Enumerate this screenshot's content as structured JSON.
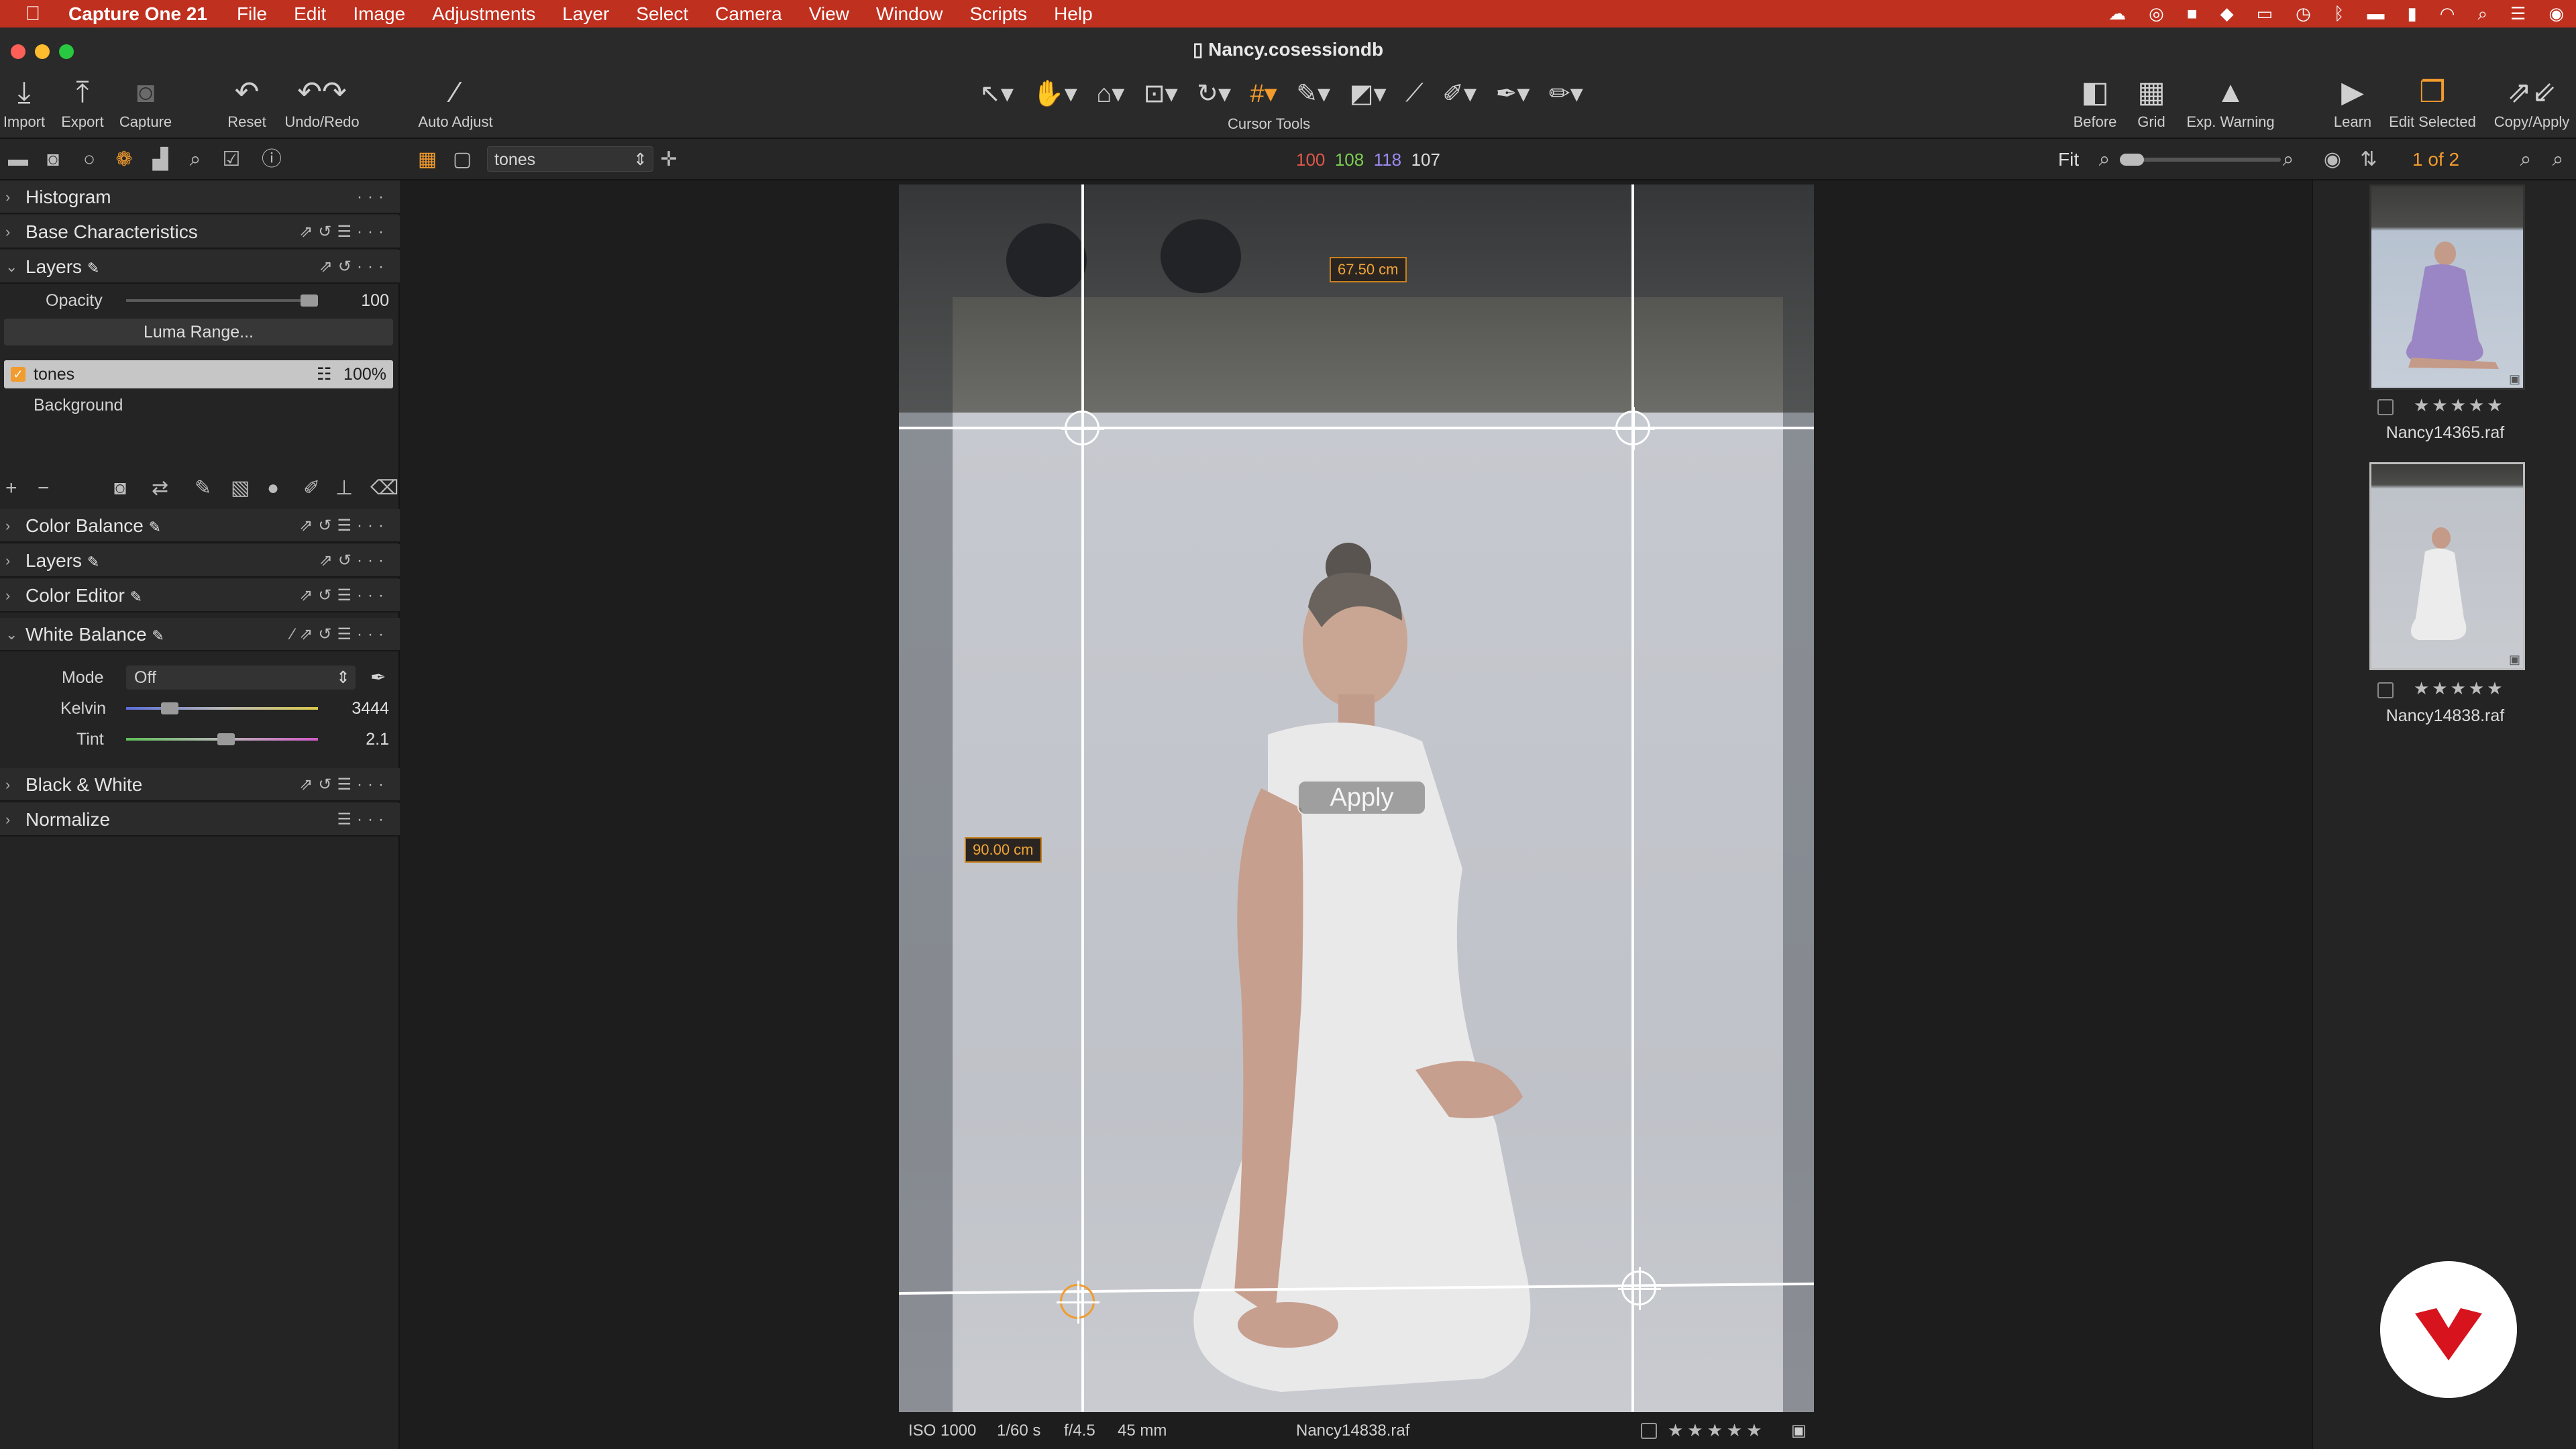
{
  "menubar": {
    "app": "Capture One 21",
    "items": [
      "File",
      "Edit",
      "Image",
      "Adjustments",
      "Layer",
      "Select",
      "Camera",
      "View",
      "Window",
      "Scripts",
      "Help"
    ]
  },
  "window": {
    "title": "Nancy.cosessiondb"
  },
  "toolbar": {
    "import": "Import",
    "export": "Export",
    "capture": "Capture",
    "reset": "Reset",
    "undo_redo": "Undo/Redo",
    "auto_adjust": "Auto Adjust",
    "cursor_tools": "Cursor Tools",
    "before": "Before",
    "grid": "Grid",
    "exp_warning": "Exp. Warning",
    "learn": "Learn",
    "edit_selected": "Edit Selected",
    "copy_apply": "Copy/Apply"
  },
  "secbar": {
    "variant_name": "tones",
    "readout": {
      "r": "100",
      "g": "108",
      "b": "118",
      "l": "107"
    },
    "fit": "Fit",
    "counter": "1 of 2"
  },
  "colors": {
    "accent": "#f29b2e",
    "menubar": "#c0301f",
    "r": "#e0574a",
    "g": "#7ccf52",
    "b": "#9a8cf0"
  },
  "left": {
    "histogram": "Histogram",
    "base": "Base Characteristics",
    "layers1": "Layers",
    "opacity_label": "Opacity",
    "opacity_value": "100",
    "opacity_level": 1.0,
    "luma": "Luma Range...",
    "layer_tones": "tones",
    "layer_tones_pct": "100%",
    "layer_background": "Background",
    "color_balance": "Color Balance",
    "layers2": "Layers",
    "color_editor": "Color Editor",
    "white_balance": "White Balance",
    "mode_label": "Mode",
    "mode_value": "Off",
    "kelvin_label": "Kelvin",
    "kelvin_value": "3444",
    "tint_label": "Tint",
    "tint_value": "2.1",
    "bw": "Black & White",
    "normalize": "Normalize"
  },
  "viewer": {
    "width_label": "67.50 cm",
    "height_label": "90.00 cm",
    "apply": "Apply",
    "iso": "ISO 1000",
    "shutter": "1/60 s",
    "aperture": "f/4.5",
    "focal": "45 mm",
    "filename": "Nancy14838.raf"
  },
  "browser": {
    "thumb1": "Nancy14365.raf",
    "thumb2": "Nancy14838.raf",
    "stars": "★★★★★"
  }
}
